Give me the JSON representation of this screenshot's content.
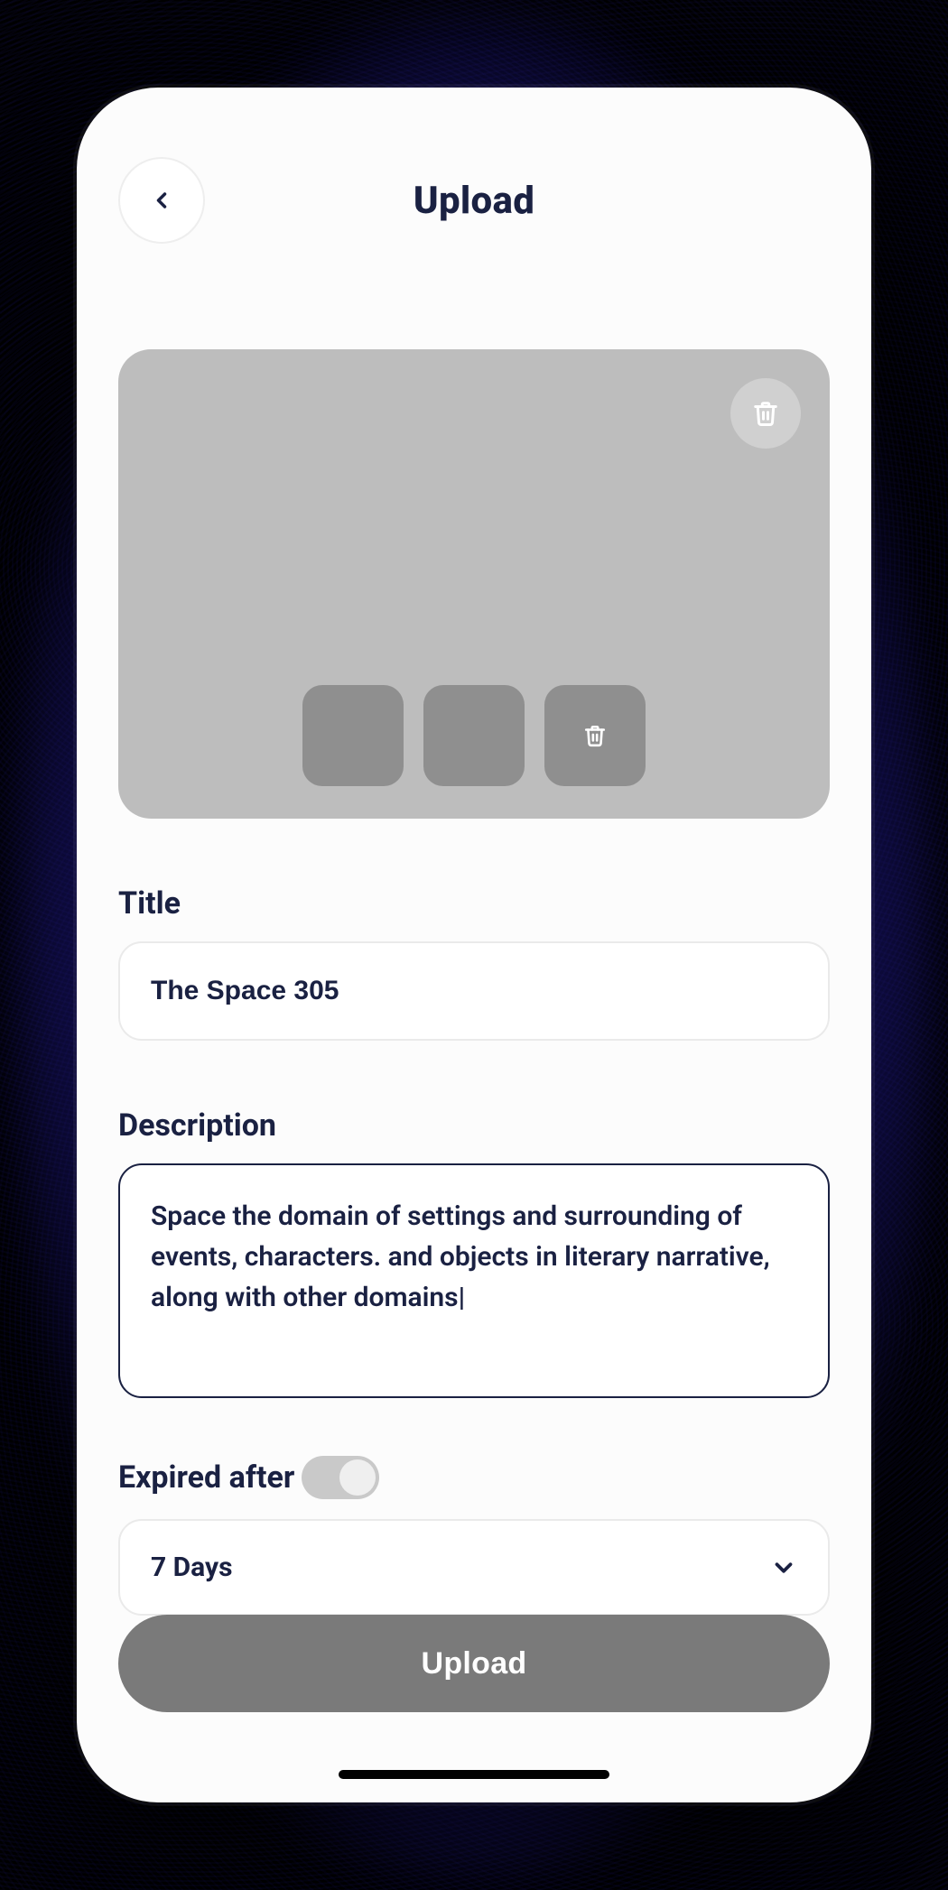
{
  "header": {
    "title": "Upload"
  },
  "preview": {
    "delete_icon": "trash-icon",
    "thumbnails": [
      {
        "has_delete": false
      },
      {
        "has_delete": false
      },
      {
        "has_delete": true
      }
    ]
  },
  "form": {
    "title_label": "Title",
    "title_value": "The Space 305",
    "description_label": "Description",
    "description_value": "Space the domain of settings and surrounding of events, characters. and objects in literary narrative, along with other domains|",
    "expired_label": "Expired after",
    "expired_toggle_on": true,
    "expired_value": "7 Days"
  },
  "actions": {
    "upload_label": "Upload"
  },
  "colors": {
    "text_primary": "#1a2142",
    "bg_preview": "#bdbdbd",
    "thumb": "#8f8f8f",
    "button": "#7a7a7a"
  }
}
